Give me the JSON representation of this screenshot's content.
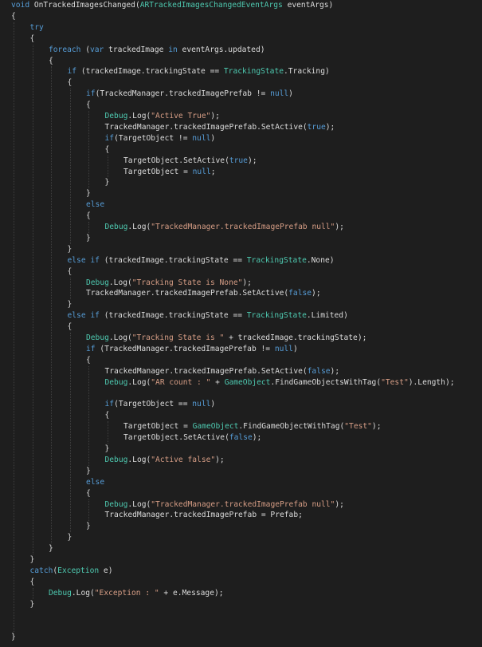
{
  "palette": {
    "background": "#1e1e1e",
    "keyword": "#569cd6",
    "type": "#4ec9b0",
    "string": "#d69d85",
    "identifier": "#dcdcdc"
  },
  "code": {
    "lines": [
      {
        "indent": 0,
        "tokens": [
          [
            "kw",
            "void"
          ],
          [
            "id",
            " OnTrackedImagesChanged("
          ],
          [
            "type",
            "ARTrackedImagesChangedEventArgs"
          ],
          [
            "id",
            " eventArgs)"
          ]
        ]
      },
      {
        "indent": 0,
        "tokens": [
          [
            "id",
            "{"
          ]
        ]
      },
      {
        "indent": 1,
        "tokens": [
          [
            "kw",
            "try"
          ]
        ]
      },
      {
        "indent": 1,
        "tokens": [
          [
            "id",
            "{"
          ]
        ]
      },
      {
        "indent": 2,
        "tokens": [
          [
            "kw",
            "foreach"
          ],
          [
            "id",
            " ("
          ],
          [
            "kw",
            "var"
          ],
          [
            "id",
            " trackedImage "
          ],
          [
            "kw",
            "in"
          ],
          [
            "id",
            " eventArgs.updated)"
          ]
        ]
      },
      {
        "indent": 2,
        "tokens": [
          [
            "id",
            "{"
          ]
        ]
      },
      {
        "indent": 3,
        "tokens": [
          [
            "kw",
            "if"
          ],
          [
            "id",
            " (trackedImage.trackingState == "
          ],
          [
            "type",
            "TrackingState"
          ],
          [
            "id",
            ".Tracking)"
          ]
        ]
      },
      {
        "indent": 3,
        "tokens": [
          [
            "id",
            "{"
          ]
        ]
      },
      {
        "indent": 4,
        "tokens": [
          [
            "kw",
            "if"
          ],
          [
            "id",
            "(TrackedManager.trackedImagePrefab != "
          ],
          [
            "kw",
            "null"
          ],
          [
            "id",
            ")"
          ]
        ]
      },
      {
        "indent": 4,
        "tokens": [
          [
            "id",
            "{"
          ]
        ]
      },
      {
        "indent": 5,
        "tokens": [
          [
            "type",
            "Debug"
          ],
          [
            "id",
            ".Log("
          ],
          [
            "str",
            "\"Active True\""
          ],
          [
            "id",
            ");"
          ]
        ]
      },
      {
        "indent": 5,
        "tokens": [
          [
            "id",
            "TrackedManager.trackedImagePrefab.SetActive("
          ],
          [
            "kw",
            "true"
          ],
          [
            "id",
            ");"
          ]
        ]
      },
      {
        "indent": 5,
        "tokens": [
          [
            "kw",
            "if"
          ],
          [
            "id",
            "(TargetObject != "
          ],
          [
            "kw",
            "null"
          ],
          [
            "id",
            ")"
          ]
        ]
      },
      {
        "indent": 5,
        "tokens": [
          [
            "id",
            "{"
          ]
        ]
      },
      {
        "indent": 6,
        "tokens": [
          [
            "id",
            "TargetObject.SetActive("
          ],
          [
            "kw",
            "true"
          ],
          [
            "id",
            ");"
          ]
        ]
      },
      {
        "indent": 6,
        "tokens": [
          [
            "id",
            "TargetObject = "
          ],
          [
            "kw",
            "null"
          ],
          [
            "id",
            ";"
          ]
        ]
      },
      {
        "indent": 5,
        "tokens": [
          [
            "id",
            "}"
          ]
        ]
      },
      {
        "indent": 4,
        "tokens": [
          [
            "id",
            "}"
          ]
        ]
      },
      {
        "indent": 4,
        "tokens": [
          [
            "kw",
            "else"
          ]
        ]
      },
      {
        "indent": 4,
        "tokens": [
          [
            "id",
            "{"
          ]
        ]
      },
      {
        "indent": 5,
        "tokens": [
          [
            "type",
            "Debug"
          ],
          [
            "id",
            ".Log("
          ],
          [
            "str",
            "\"TrackedManager.trackedImagePrefab null\""
          ],
          [
            "id",
            ");"
          ]
        ]
      },
      {
        "indent": 4,
        "tokens": [
          [
            "id",
            "}"
          ]
        ]
      },
      {
        "indent": 3,
        "tokens": [
          [
            "id",
            "}"
          ]
        ]
      },
      {
        "indent": 3,
        "tokens": [
          [
            "kw",
            "else if"
          ],
          [
            "id",
            " (trackedImage.trackingState == "
          ],
          [
            "type",
            "TrackingState"
          ],
          [
            "id",
            ".None)"
          ]
        ]
      },
      {
        "indent": 3,
        "tokens": [
          [
            "id",
            "{"
          ]
        ]
      },
      {
        "indent": 4,
        "tokens": [
          [
            "type",
            "Debug"
          ],
          [
            "id",
            ".Log("
          ],
          [
            "str",
            "\"Tracking State is None\""
          ],
          [
            "id",
            ");"
          ]
        ]
      },
      {
        "indent": 4,
        "tokens": [
          [
            "id",
            "TrackedManager.trackedImagePrefab.SetActive("
          ],
          [
            "kw",
            "false"
          ],
          [
            "id",
            ");"
          ]
        ]
      },
      {
        "indent": 3,
        "tokens": [
          [
            "id",
            "}"
          ]
        ]
      },
      {
        "indent": 3,
        "tokens": [
          [
            "kw",
            "else if"
          ],
          [
            "id",
            " (trackedImage.trackingState == "
          ],
          [
            "type",
            "TrackingState"
          ],
          [
            "id",
            ".Limited)"
          ]
        ]
      },
      {
        "indent": 3,
        "tokens": [
          [
            "id",
            "{"
          ]
        ]
      },
      {
        "indent": 4,
        "tokens": [
          [
            "type",
            "Debug"
          ],
          [
            "id",
            ".Log("
          ],
          [
            "str",
            "\"Tracking State is \""
          ],
          [
            "id",
            " + trackedImage.trackingState);"
          ]
        ]
      },
      {
        "indent": 4,
        "tokens": [
          [
            "kw",
            "if"
          ],
          [
            "id",
            " (TrackedManager.trackedImagePrefab != "
          ],
          [
            "kw",
            "null"
          ],
          [
            "id",
            ")"
          ]
        ]
      },
      {
        "indent": 4,
        "tokens": [
          [
            "id",
            "{"
          ]
        ]
      },
      {
        "indent": 5,
        "tokens": [
          [
            "id",
            "TrackedManager.trackedImagePrefab.SetActive("
          ],
          [
            "kw",
            "false"
          ],
          [
            "id",
            ");"
          ]
        ]
      },
      {
        "indent": 5,
        "tokens": [
          [
            "type",
            "Debug"
          ],
          [
            "id",
            ".Log("
          ],
          [
            "str",
            "\"AR count : \""
          ],
          [
            "id",
            " + "
          ],
          [
            "type",
            "GameObject"
          ],
          [
            "id",
            ".FindGameObjectsWithTag("
          ],
          [
            "str",
            "\"Test\""
          ],
          [
            "id",
            ").Length);"
          ]
        ]
      },
      {
        "indent": 5,
        "tokens": []
      },
      {
        "indent": 5,
        "tokens": [
          [
            "kw",
            "if"
          ],
          [
            "id",
            "(TargetObject == "
          ],
          [
            "kw",
            "null"
          ],
          [
            "id",
            ")"
          ]
        ]
      },
      {
        "indent": 5,
        "tokens": [
          [
            "id",
            "{"
          ]
        ]
      },
      {
        "indent": 6,
        "tokens": [
          [
            "id",
            "TargetObject = "
          ],
          [
            "type",
            "GameObject"
          ],
          [
            "id",
            ".FindGameObjectWithTag("
          ],
          [
            "str",
            "\"Test\""
          ],
          [
            "id",
            ");"
          ]
        ]
      },
      {
        "indent": 6,
        "tokens": [
          [
            "id",
            "TargetObject.SetActive("
          ],
          [
            "kw",
            "false"
          ],
          [
            "id",
            ");"
          ]
        ]
      },
      {
        "indent": 5,
        "tokens": [
          [
            "id",
            "}"
          ]
        ]
      },
      {
        "indent": 5,
        "tokens": [
          [
            "type",
            "Debug"
          ],
          [
            "id",
            ".Log("
          ],
          [
            "str",
            "\"Active false\""
          ],
          [
            "id",
            ");"
          ]
        ]
      },
      {
        "indent": 4,
        "tokens": [
          [
            "id",
            "}"
          ]
        ]
      },
      {
        "indent": 4,
        "tokens": [
          [
            "kw",
            "else"
          ]
        ]
      },
      {
        "indent": 4,
        "tokens": [
          [
            "id",
            "{"
          ]
        ]
      },
      {
        "indent": 5,
        "tokens": [
          [
            "type",
            "Debug"
          ],
          [
            "id",
            ".Log("
          ],
          [
            "str",
            "\"TrackedManager.trackedImagePrefab null\""
          ],
          [
            "id",
            ");"
          ]
        ]
      },
      {
        "indent": 5,
        "tokens": [
          [
            "id",
            "TrackedManager.trackedImagePrefab = Prefab;"
          ]
        ]
      },
      {
        "indent": 4,
        "tokens": [
          [
            "id",
            "}"
          ]
        ]
      },
      {
        "indent": 3,
        "tokens": [
          [
            "id",
            "}"
          ]
        ]
      },
      {
        "indent": 2,
        "tokens": [
          [
            "id",
            "}"
          ]
        ]
      },
      {
        "indent": 1,
        "tokens": [
          [
            "id",
            "}"
          ]
        ]
      },
      {
        "indent": 1,
        "tokens": [
          [
            "kw",
            "catch"
          ],
          [
            "id",
            "("
          ],
          [
            "type",
            "Exception"
          ],
          [
            "id",
            " e)"
          ]
        ]
      },
      {
        "indent": 1,
        "tokens": [
          [
            "id",
            "{"
          ]
        ]
      },
      {
        "indent": 2,
        "tokens": [
          [
            "type",
            "Debug"
          ],
          [
            "id",
            ".Log("
          ],
          [
            "str",
            "\"Exception : \""
          ],
          [
            "id",
            " + e.Message);"
          ]
        ]
      },
      {
        "indent": 1,
        "tokens": [
          [
            "id",
            "}"
          ]
        ]
      },
      {
        "indent": 0,
        "tokens": []
      },
      {
        "indent": 0,
        "tokens": []
      },
      {
        "indent": 0,
        "tokens": [
          [
            "id",
            "}"
          ]
        ]
      }
    ]
  }
}
